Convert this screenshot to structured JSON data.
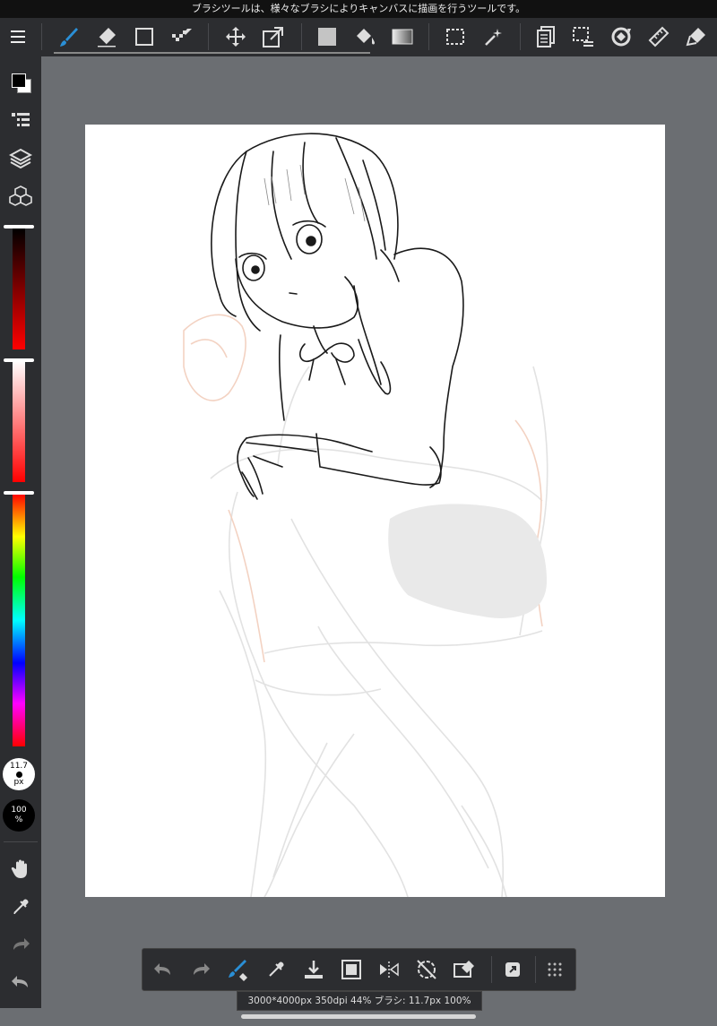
{
  "tooltip": "ブラシツールは、様々なブラシによりキャンバスに描画を行うツールです。",
  "toolbar": {
    "icons": [
      "menu-icon",
      "brush-icon",
      "eraser-icon",
      "shape-rect-icon",
      "dot-pen-icon",
      "move-icon",
      "transform-icon",
      "fill-color-icon",
      "bucket-icon",
      "gradient-icon",
      "select-rect-icon",
      "magic-wand-icon",
      "copy-page-icon",
      "deselect-icon",
      "rotate-icon",
      "ruler-icon",
      "snap-icon"
    ],
    "active_tool": "brush",
    "accent_color": "#2a8fd6"
  },
  "sidebar": {
    "brush_size_value": "11.7",
    "brush_size_unit": "px",
    "opacity_value": "100",
    "opacity_unit": "%",
    "primary_color": "#000000",
    "secondary_color": "#ffffff"
  },
  "statusbar": {
    "info": "3000*4000px 350dpi 44% ブラシ: 11.7px 100%"
  }
}
